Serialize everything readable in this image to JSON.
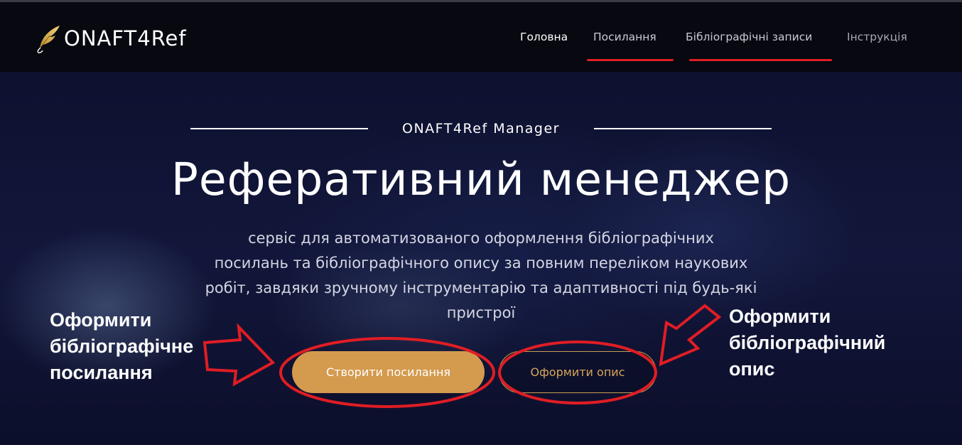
{
  "header": {
    "logo_text": "ONAFT4Ref",
    "logo_icon": "quill-feather-icon",
    "nav": [
      {
        "label": "Головна",
        "active": true
      },
      {
        "label": "Посилання",
        "highlighted": true
      },
      {
        "label": "Бібліографічні записи",
        "highlighted": true
      },
      {
        "label": "Інструкція"
      }
    ]
  },
  "hero": {
    "kicker": "ONAFT4Ref Manager",
    "title": "Реферативний менеджер",
    "subtitle": [
      "сервіс для автоматизованого оформлення бібліографічних",
      "посилань та бібліографічного опису за повним переліком наукових",
      "робіт, завдяки зручному інструментарію та адаптивності під будь-які",
      "пристрої"
    ],
    "primary_button": "Створити посилання",
    "secondary_button": "Оформити опис"
  },
  "annotations": {
    "left": [
      "Оформити",
      "бібліографічне",
      "посилання"
    ],
    "right": [
      "Оформити",
      "бібліографічний",
      "опис"
    ]
  },
  "colors": {
    "accent_gold": "#d49a4e",
    "annotation_red": "#e01d24",
    "header_bg": "#070810",
    "hero_bg": "#10143a"
  }
}
